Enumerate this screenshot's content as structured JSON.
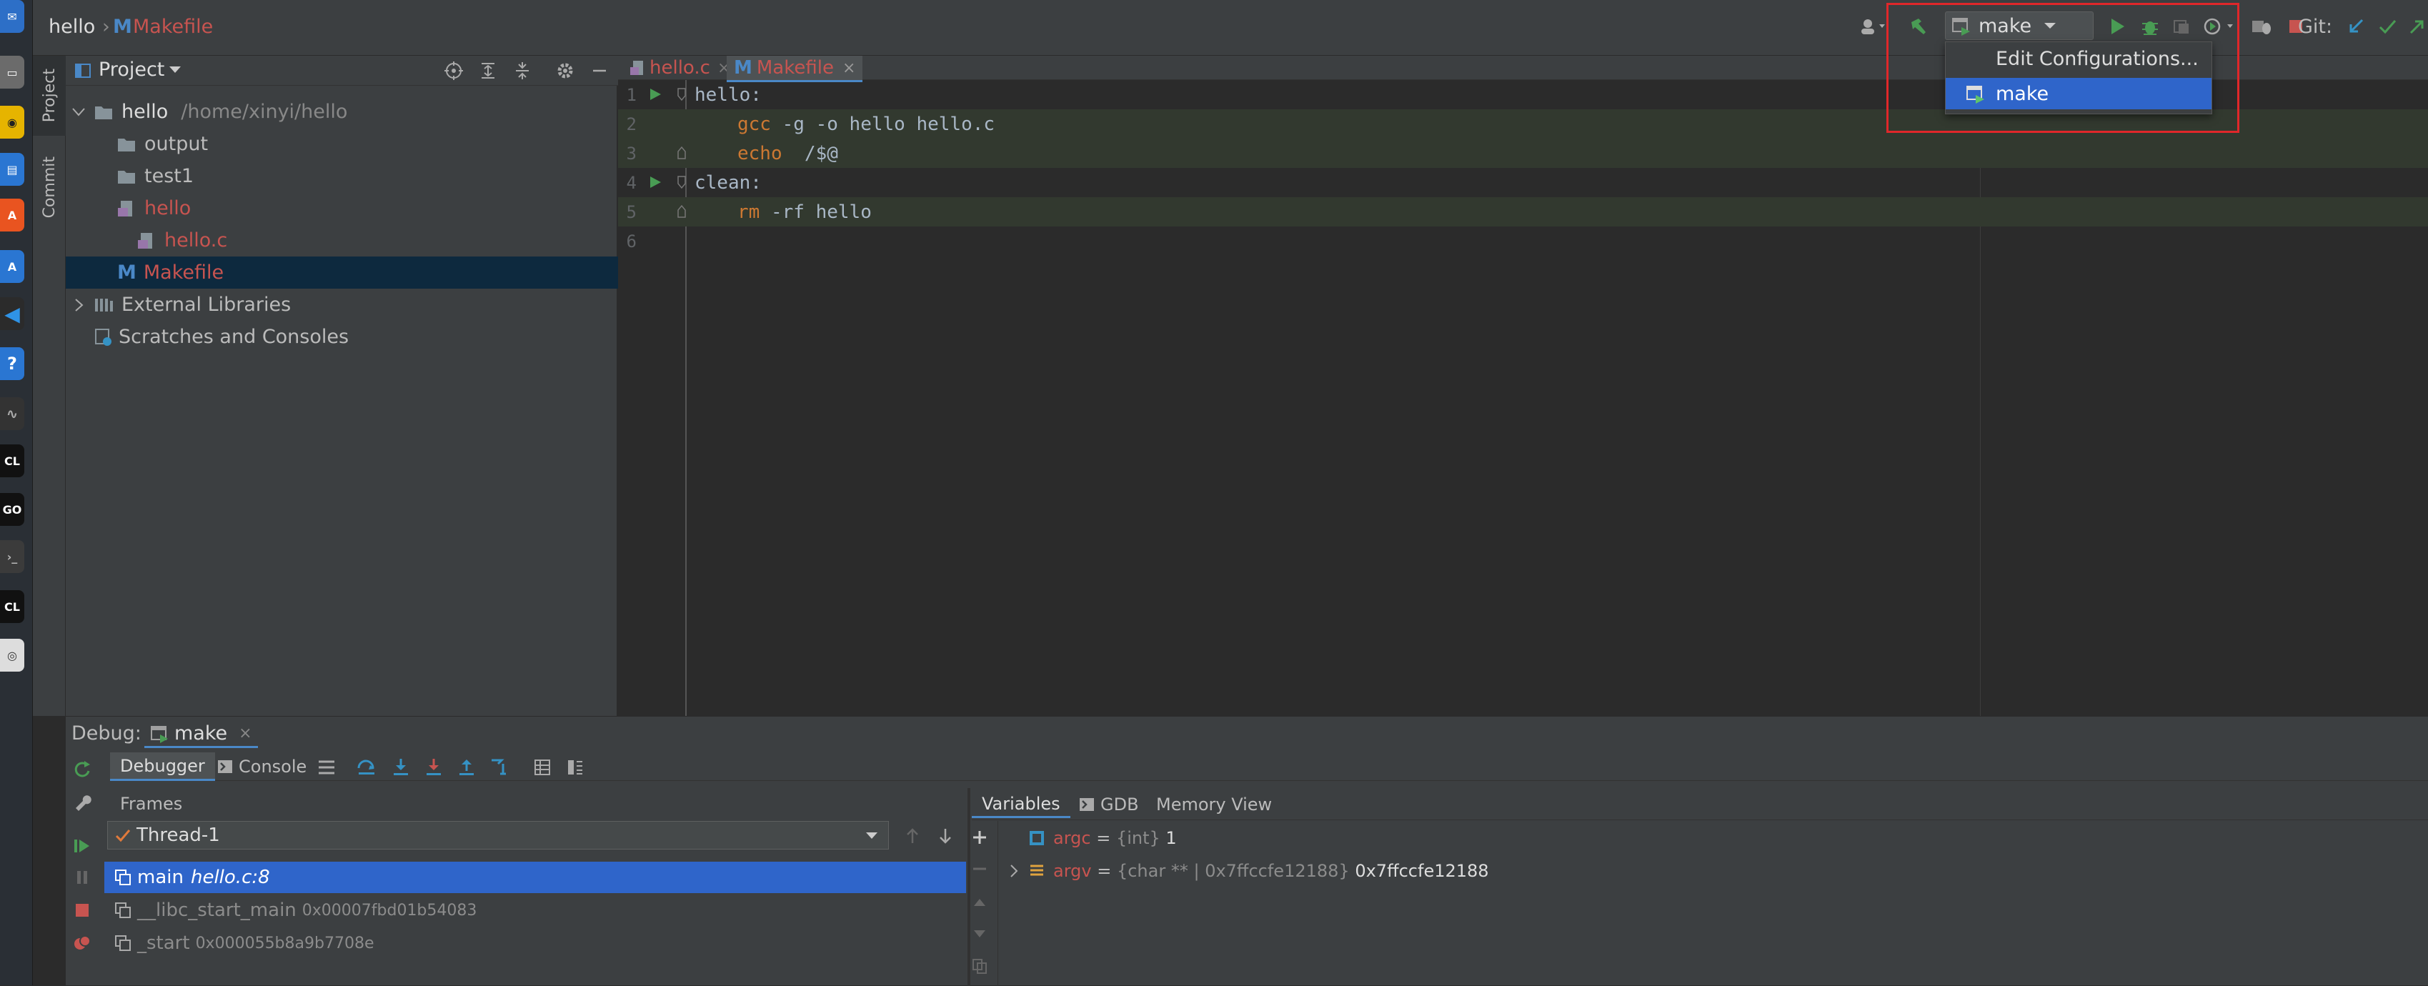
{
  "breadcrumb": {
    "project": "hello",
    "file": "Makefile",
    "file_icon": "M"
  },
  "toolbar": {
    "run_config": "make",
    "git_label": "Git:"
  },
  "config_dropdown": {
    "edit_label": "Edit Configurations...",
    "item_label": "make"
  },
  "side_tabs": {
    "project": "Project",
    "commit": "Commit"
  },
  "project_panel": {
    "title": "Project",
    "root": {
      "name": "hello",
      "path": "/home/xinyi/hello"
    },
    "items": [
      "output",
      "test1",
      "hello",
      "hello.c",
      "Makefile"
    ],
    "external": "External Libraries",
    "scratches": "Scratches and Consoles"
  },
  "editor": {
    "tabs": [
      "hello.c",
      "Makefile"
    ],
    "line_numbers": [
      "1",
      "2",
      "3",
      "4",
      "5",
      "6"
    ],
    "lines": [
      {
        "text": "hello:"
      },
      {
        "kw": "gcc",
        "rest": " -g -o hello hello.c"
      },
      {
        "kw": "echo",
        "rest": "  /$@"
      },
      {
        "text": "clean:"
      },
      {
        "kw": "rm",
        "rest": " -rf hello"
      },
      {
        "text": ""
      }
    ]
  },
  "debug": {
    "label": "Debug:",
    "session": "make",
    "tabs": {
      "debugger": "Debugger",
      "console": "Console"
    },
    "frames_label": "Frames",
    "thread": "Thread-1",
    "frames": [
      {
        "name": "main",
        "loc": "hello.c:8"
      },
      {
        "name": "__libc_start_main",
        "loc": "0x00007fbd01b54083"
      },
      {
        "name": "_start",
        "loc": "0x000055b8a9b7708e"
      }
    ],
    "var_tabs": {
      "variables": "Variables",
      "gdb": "GDB",
      "memory": "Memory View"
    },
    "variables": [
      {
        "name": "argc",
        "eq": " = ",
        "type": "{int}",
        "value": " 1"
      },
      {
        "name": "argv",
        "eq": " = ",
        "type": "{char ** | 0x7ffccfe12188}",
        "value": " 0x7ffccfe12188"
      }
    ]
  },
  "colors": {
    "accent": "#4a88c7",
    "selection": "#2f65ca",
    "modified_file": "#c75450",
    "run_green": "#499c54",
    "keyword": "#cc7832",
    "highlight": "#e0272a"
  }
}
